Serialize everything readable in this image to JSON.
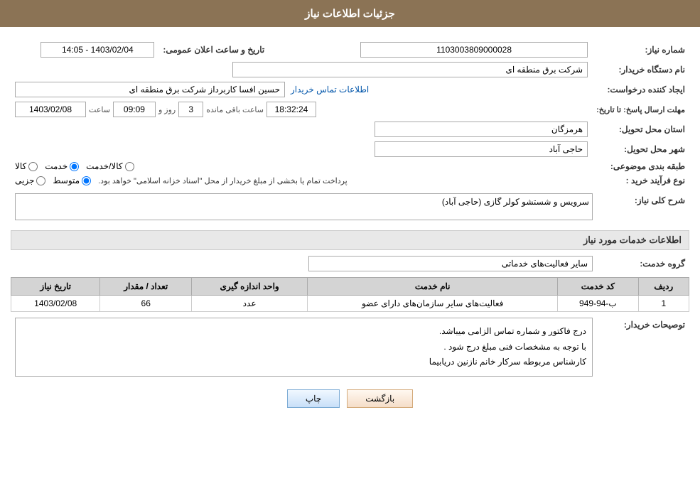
{
  "header": {
    "title": "جزئیات اطلاعات نیاز"
  },
  "fields": {
    "shomareNiaz_label": "شماره نیاز:",
    "shomareNiaz_value": "1103003809000028",
    "namDastgah_label": "نام دستگاه خریدار:",
    "namDastgah_value": "شرکت برق منطقه ای",
    "ijadKonande_label": "ایجاد کننده درخواست:",
    "ijadKonande_value": "حسین افسا کاربرداز شرکت برق منطقه ای",
    "ijadKonande_link": "اطلاعات تماس خریدار",
    "mohlat_label": "مهلت ارسال پاسخ: تا تاریخ:",
    "date_value": "1403/02/08",
    "time_label": "ساعت",
    "time_value": "09:09",
    "rooz_label": "روز و",
    "rooz_value": "3",
    "remaining_label": "ساعت باقی مانده",
    "remaining_value": "18:32:24",
    "tarikh_ilan_label": "تاریخ و ساعت اعلان عمومی:",
    "tarikh_ilan_value": "1403/02/04 - 14:05",
    "ostan_label": "استان محل تحویل:",
    "ostan_value": "هرمزگان",
    "shahr_label": "شهر محل تحویل:",
    "shahr_value": "حاجی آباد",
    "tabaqe_label": "طبقه بندی موضوعی:",
    "tabaqe_options": [
      {
        "label": "کالا",
        "selected": false
      },
      {
        "label": "خدمت",
        "selected": true
      },
      {
        "label": "کالا/خدمت",
        "selected": false
      }
    ],
    "noefarayand_label": "نوع فرآیند خرید :",
    "noefarayand_options": [
      {
        "label": "جزیی",
        "selected": false
      },
      {
        "label": "متوسط",
        "selected": true
      }
    ],
    "noefarayand_note": "پرداخت تمام یا بخشی از مبلغ خریدار از محل \"اسناد خزانه اسلامی\" خواهد بود."
  },
  "sharhKoli": {
    "title": "شرح کلی نیاز:",
    "value": "سرویس و شستشو کولر گازی (حاجی آباد)"
  },
  "khadamat": {
    "title": "اطلاعات خدمات مورد نیاز",
    "goroh_label": "گروه خدمت:",
    "goroh_value": "سایر فعالیت‌های خدماتی",
    "table": {
      "headers": [
        "ردیف",
        "کد خدمت",
        "نام خدمت",
        "واحد اندازه گیری",
        "تعداد / مقدار",
        "تاریخ نیاز"
      ],
      "rows": [
        {
          "radif": "1",
          "kod": "ب-94-949",
          "nam": "فعالیت‌های سایر سازمان‌های دارای عضو",
          "vahed": "عدد",
          "tedad": "66",
          "tarikh": "1403/02/08"
        }
      ]
    }
  },
  "description": {
    "title": "توصیحات خریدار:",
    "lines": [
      "درج فاکتور و شماره تماس الزامی میباشد.",
      "با توجه به مشخصات فنی مبلغ درج شود .",
      "کارشناس مربوطه سرکار خانم نازنین دریابیما"
    ]
  },
  "buttons": {
    "print": "چاپ",
    "back": "بازگشت"
  }
}
